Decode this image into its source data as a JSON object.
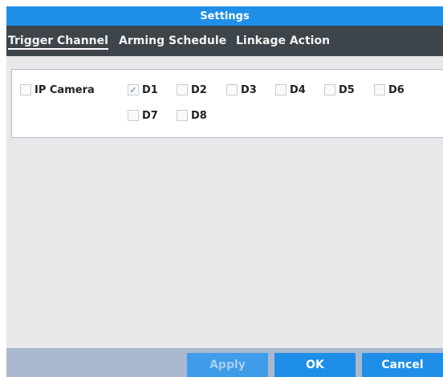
{
  "dialog": {
    "title": "Settings"
  },
  "tabs": [
    {
      "label": "Trigger Channel",
      "active": true
    },
    {
      "label": "Arming Schedule",
      "active": false
    },
    {
      "label": "Linkage Action",
      "active": false
    }
  ],
  "channels": {
    "ip_camera": {
      "label": "IP Camera",
      "checked": false
    },
    "items": [
      {
        "label": "D1",
        "checked": true
      },
      {
        "label": "D2",
        "checked": false
      },
      {
        "label": "D3",
        "checked": false
      },
      {
        "label": "D4",
        "checked": false
      },
      {
        "label": "D5",
        "checked": false
      },
      {
        "label": "D6",
        "checked": false
      },
      {
        "label": "D7",
        "checked": false
      },
      {
        "label": "D8",
        "checked": false
      }
    ],
    "check_glyph": "✓"
  },
  "footer": {
    "apply": {
      "label": "Apply",
      "enabled": false
    },
    "ok": {
      "label": "OK",
      "enabled": true
    },
    "cancel": {
      "label": "Cancel",
      "enabled": true
    }
  },
  "colors": {
    "title_bar": "#1f8ee8",
    "tab_bar": "#3d444a",
    "body": "#e7e8ea",
    "footer": "#aab9cf",
    "button": "#1f8ee8"
  }
}
